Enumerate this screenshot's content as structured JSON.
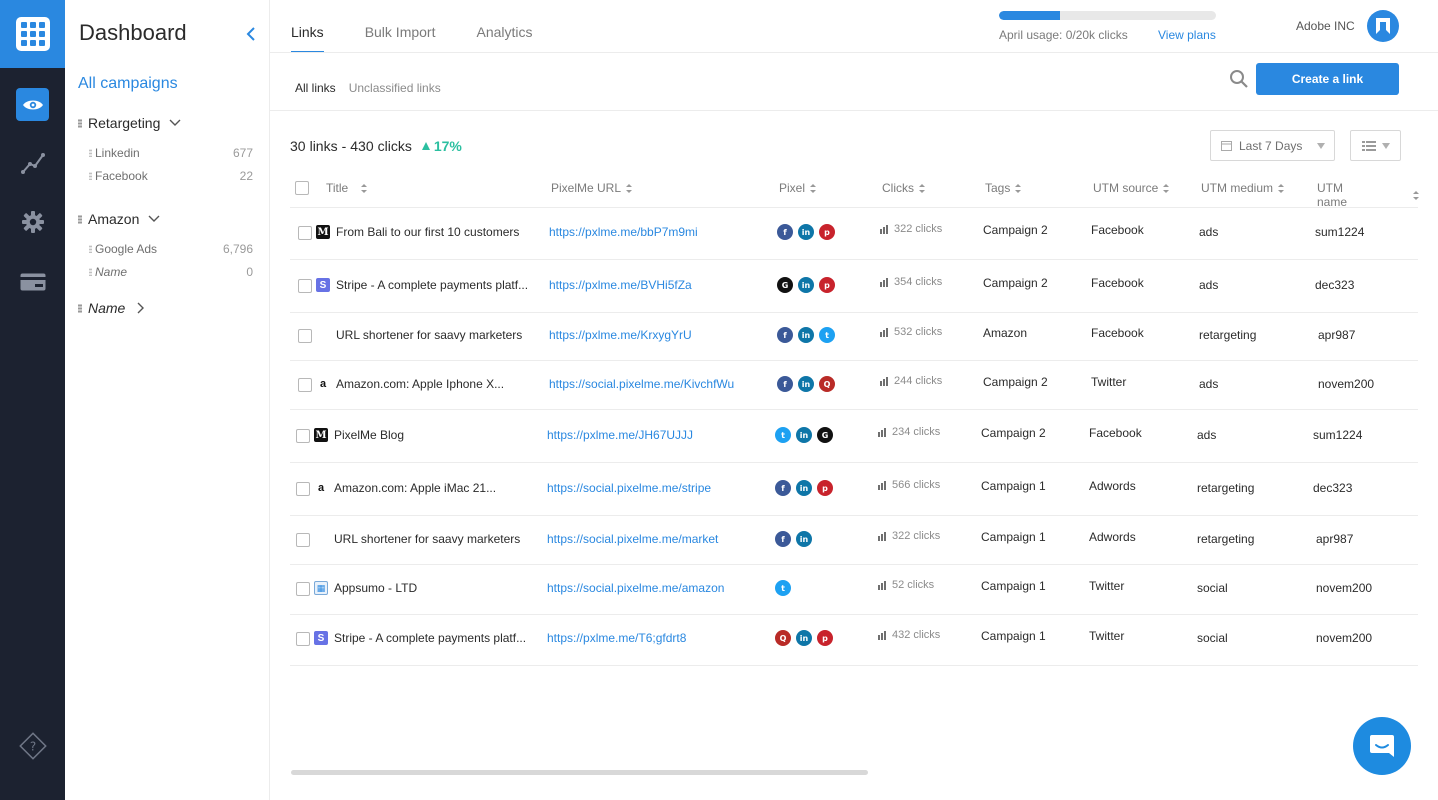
{
  "rail": {
    "items": [
      "eye-icon",
      "chart-line-icon",
      "gear-icon",
      "credit-card-icon"
    ],
    "help_icon": "question-icon"
  },
  "sidebar": {
    "title": "Dashboard",
    "all_campaigns": "All campaigns",
    "groups": [
      {
        "label": "Retargeting",
        "items": [
          {
            "name": "Linkedin",
            "count": "677"
          },
          {
            "name": "Facebook",
            "count": "22"
          }
        ]
      },
      {
        "label": "Amazon",
        "items": [
          {
            "name": "Google Ads",
            "count": "6,796"
          },
          {
            "name": "Name",
            "count": "0"
          }
        ]
      },
      {
        "label": "Name",
        "items": []
      }
    ]
  },
  "header": {
    "tabs": [
      "Links",
      "Bulk Import",
      "Analytics"
    ],
    "usage_text": "April usage: 0/20k clicks",
    "usage_fraction": 0.28,
    "view_plans": "View plans",
    "company": "Adobe INC"
  },
  "subtabs": [
    "All links",
    "Unclassified links"
  ],
  "create_button": "Create a link",
  "summary": {
    "links": "30",
    "links_label": "links",
    "sep": "-",
    "clicks": "430",
    "clicks_label": "clicks",
    "pct": "17%"
  },
  "date_filter": "Last 7 Days",
  "table": {
    "columns": [
      "Title",
      "PixelMe URL",
      "Pixel",
      "Clicks",
      "Tags",
      "UTM source",
      "UTM medium",
      "UTM name"
    ],
    "rows": [
      {
        "favicon": "medium",
        "title": "From Bali to our first 10 customers",
        "url": "https://pxlme.me/bbP7m9mi",
        "pixels": [
          "fb",
          "li",
          "pin"
        ],
        "clicks": "322 clicks",
        "tag": "Campaign 2",
        "source": "Facebook",
        "medium": "ads",
        "name": "sum1224"
      },
      {
        "favicon": "stripe",
        "title": "Stripe -  A complete payments platf...",
        "url": "https://pxlme.me/BVHi5fZa",
        "pixels": [
          "g",
          "li",
          "pin"
        ],
        "clicks": "354 clicks",
        "tag": "Campaign 2",
        "source": "Facebook",
        "medium": "ads",
        "name": "dec323"
      },
      {
        "favicon": "grid",
        "title": "URL shortener for saavy marketers",
        "url": "https://pxlme.me/KrxygYrU",
        "pixels": [
          "fb",
          "li",
          "tw"
        ],
        "clicks": "532 clicks",
        "tag": "Amazon",
        "source": "Facebook",
        "medium": "retargeting",
        "name": "apr987"
      },
      {
        "favicon": "amazon",
        "title": "Amazon.com: Apple Iphone X...",
        "url": "https://social.pixelme.me/KivchfWu",
        "pixels": [
          "fb",
          "li",
          "q"
        ],
        "clicks": "244 clicks",
        "tag": "Campaign 2",
        "source": "Twitter",
        "medium": "ads",
        "name": "novem200"
      },
      {
        "favicon": "medium",
        "title": "PixelMe Blog",
        "url": "https://pxlme.me/JH67UJJJ",
        "pixels": [
          "tw",
          "li",
          "g"
        ],
        "clicks": "234 clicks",
        "tag": "Campaign 2",
        "source": "Facebook",
        "medium": "ads",
        "name": "sum1224"
      },
      {
        "favicon": "amazon",
        "title": "Amazon.com: Apple iMac 21...",
        "url": "https://social.pixelme.me/stripe",
        "pixels": [
          "fb",
          "li",
          "pin"
        ],
        "clicks": "566 clicks",
        "tag": "Campaign 1",
        "source": "Adwords",
        "medium": "retargeting",
        "name": "dec323"
      },
      {
        "favicon": "grid",
        "title": "URL shortener for saavy marketers",
        "url": "https://social.pixelme.me/market",
        "pixels": [
          "fb",
          "li"
        ],
        "clicks": "322 clicks",
        "tag": "Campaign 1",
        "source": "Adwords",
        "medium": "retargeting",
        "name": "apr987"
      },
      {
        "favicon": "appsumo",
        "title": "Appsumo - LTD",
        "url": "https://social.pixelme.me/amazon",
        "pixels": [
          "tw"
        ],
        "clicks": "52 clicks",
        "tag": "Campaign 1",
        "source": "Twitter",
        "medium": "social",
        "name": "novem200"
      },
      {
        "favicon": "stripe",
        "title": "Stripe -  A complete payments platf...",
        "url": "https://pxlme.me/T6;gfdrt8",
        "pixels": [
          "q",
          "li",
          "pin"
        ],
        "clicks": "432 clicks",
        "tag": "Campaign 1",
        "source": "Twitter",
        "medium": "social",
        "name": "novem200"
      }
    ]
  },
  "colors": {
    "accent": "#2a88e0",
    "rail": "#1c2230",
    "positive": "#2bbfa0"
  }
}
